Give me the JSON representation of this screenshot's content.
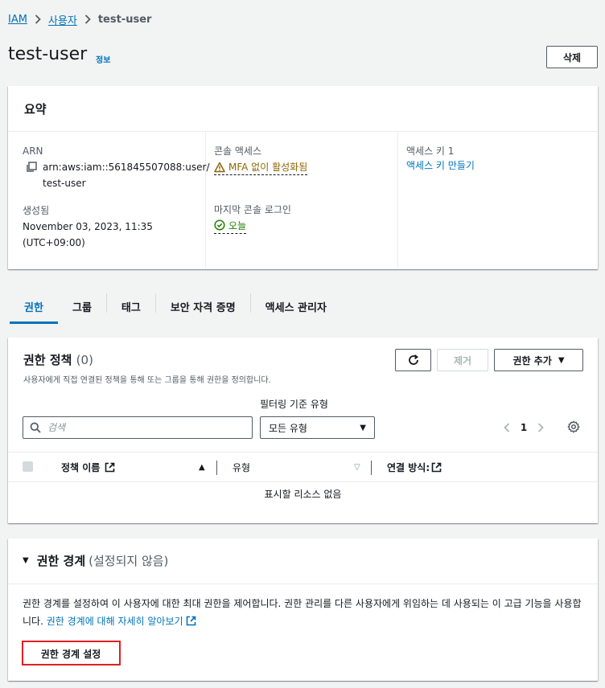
{
  "breadcrumb": {
    "items": [
      "IAM",
      "사용자"
    ],
    "current": "test-user"
  },
  "page": {
    "title": "test-user",
    "info": "정보",
    "delete_label": "삭제"
  },
  "summary": {
    "title": "요약",
    "arn_label": "ARN",
    "arn_line1": "arn:aws:iam::561845507088:user/",
    "arn_line2": "test-user",
    "created_label": "생성됨",
    "created_line1": "November 03, 2023, 11:35",
    "created_line2": "(UTC+09:00)",
    "console_access_label": "콘솔 액세스",
    "console_access_value": "MFA 없이 활성화됨",
    "last_login_label": "마지막 콘솔 로그인",
    "last_login_value": "오늘",
    "access_key_label": "액세스 키 1",
    "access_key_link": "액세스 키 만들기"
  },
  "tabs": [
    {
      "label": "권한",
      "active": true
    },
    {
      "label": "그룹"
    },
    {
      "label": "태그"
    },
    {
      "label": "보안 자격 증명"
    },
    {
      "label": "액세스 관리자"
    }
  ],
  "permissions": {
    "title": "권한 정책",
    "count": "(0)",
    "description": "사용자에게 직접 연결된 정책을 통해 또는 그룹을 통해 권한을 정의합니다.",
    "remove_label": "제거",
    "add_label": "권한 추가",
    "filter_label": "필터링 기준 유형",
    "search_placeholder": "검색",
    "select_value": "모든 유형",
    "page": "1",
    "columns": {
      "name": "정책 이름",
      "type": "유형",
      "attached": "연결 방식:"
    },
    "empty": "표시할 리소스 없음"
  },
  "boundary": {
    "title": "권한 경계",
    "status": "(설정되지 않음)",
    "text1": "권한 경계를 설정하여 이 사용자에 대한 최대 권한을 제어합니다. 권한 관리를 다른 사용자에게 위임하는 데 사용되는 이 고급 기능을 사용합니다. ",
    "link": "권한 경계에 대해 자세히 알아보기",
    "button": "권한 경계 설정"
  }
}
